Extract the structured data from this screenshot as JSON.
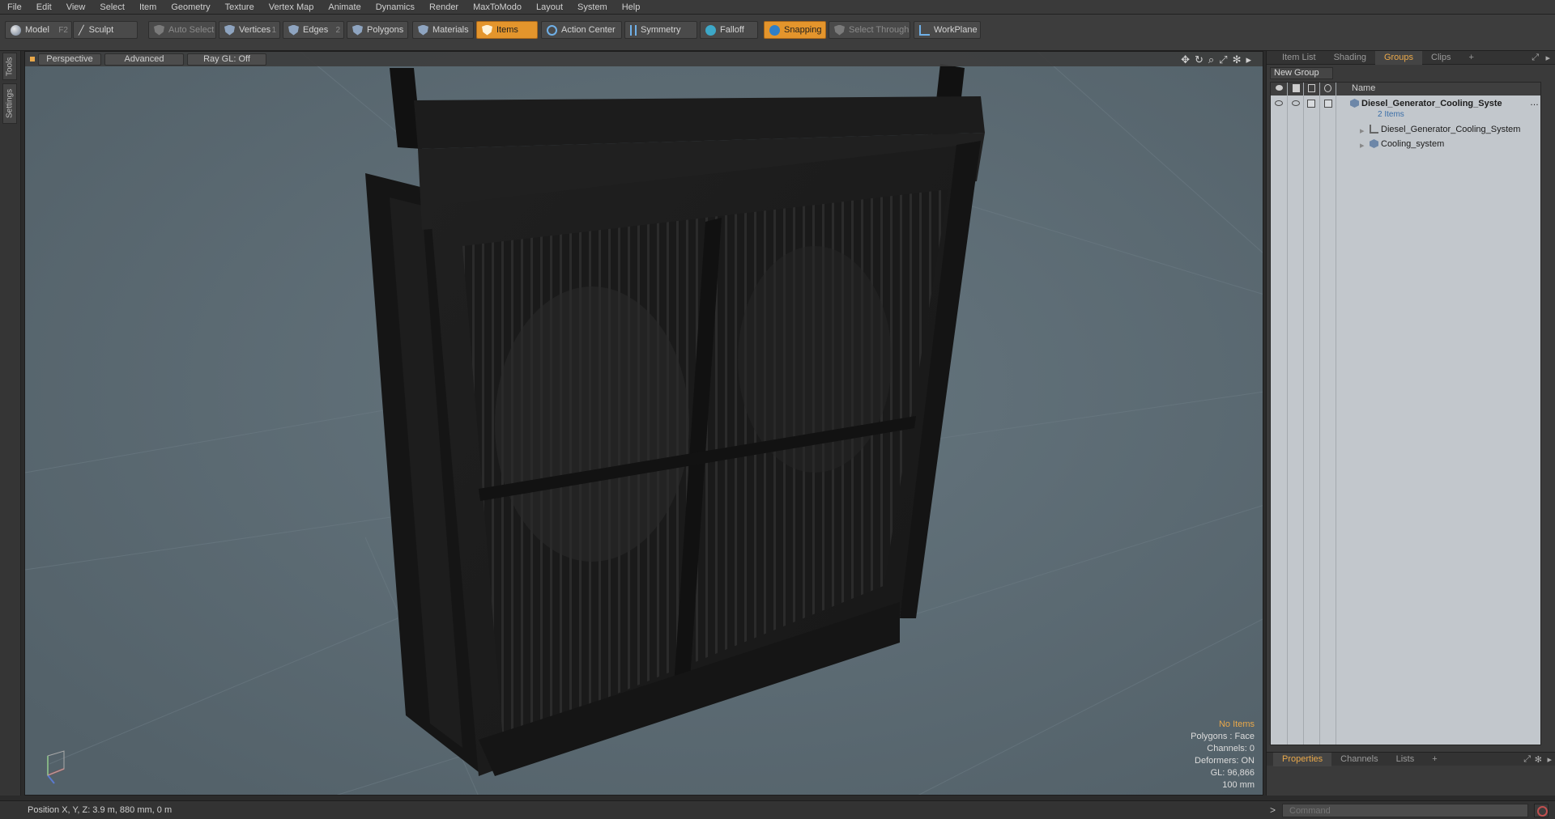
{
  "menu": [
    "File",
    "Edit",
    "View",
    "Select",
    "Item",
    "Geometry",
    "Texture",
    "Vertex Map",
    "Animate",
    "Dynamics",
    "Render",
    "MaxToModo",
    "Layout",
    "System",
    "Help"
  ],
  "toolbar": {
    "model": "Model",
    "model_key": "F2",
    "sculpt": "Sculpt",
    "auto_select": "Auto Select",
    "vertices": "Vertices",
    "vertices_key": "1",
    "edges": "Edges",
    "edges_key": "2",
    "polygons": "Polygons",
    "materials": "Materials",
    "items": "Items",
    "action_center": "Action Center",
    "symmetry": "Symmetry",
    "falloff": "Falloff",
    "snapping": "Snapping",
    "select_through": "Select Through",
    "workplane": "WorkPlane"
  },
  "left_tabs": [
    "Tools",
    "Settings"
  ],
  "viewport": {
    "perspective": "Perspective",
    "advanced": "Advanced",
    "raygl": "Ray GL: Off",
    "info": {
      "no_items": "No Items",
      "polygons": "Polygons : Face",
      "channels": "Channels: 0",
      "deformers": "Deformers: ON",
      "gl": "GL: 96,866",
      "scale": "100 mm"
    }
  },
  "right_panel": {
    "tabs": [
      "Item List",
      "Shading",
      "Groups",
      "Clips",
      "+"
    ],
    "active_tab": "Groups",
    "new_group": "New Group",
    "name_header": "Name",
    "group_name": "Diesel_Generator_Cooling_Syste",
    "group_count": "2 Items",
    "children": [
      "Diesel_Generator_Cooling_System",
      "Cooling_system"
    ],
    "bottom_tabs": [
      "Properties",
      "Channels",
      "Lists",
      "+"
    ]
  },
  "status": {
    "position": "Position X, Y, Z:  3.9 m, 880 mm, 0 m",
    "command_placeholder": "Command"
  },
  "colors": {
    "accent": "#e4952c",
    "viewport_bg": "#5b6b75"
  }
}
